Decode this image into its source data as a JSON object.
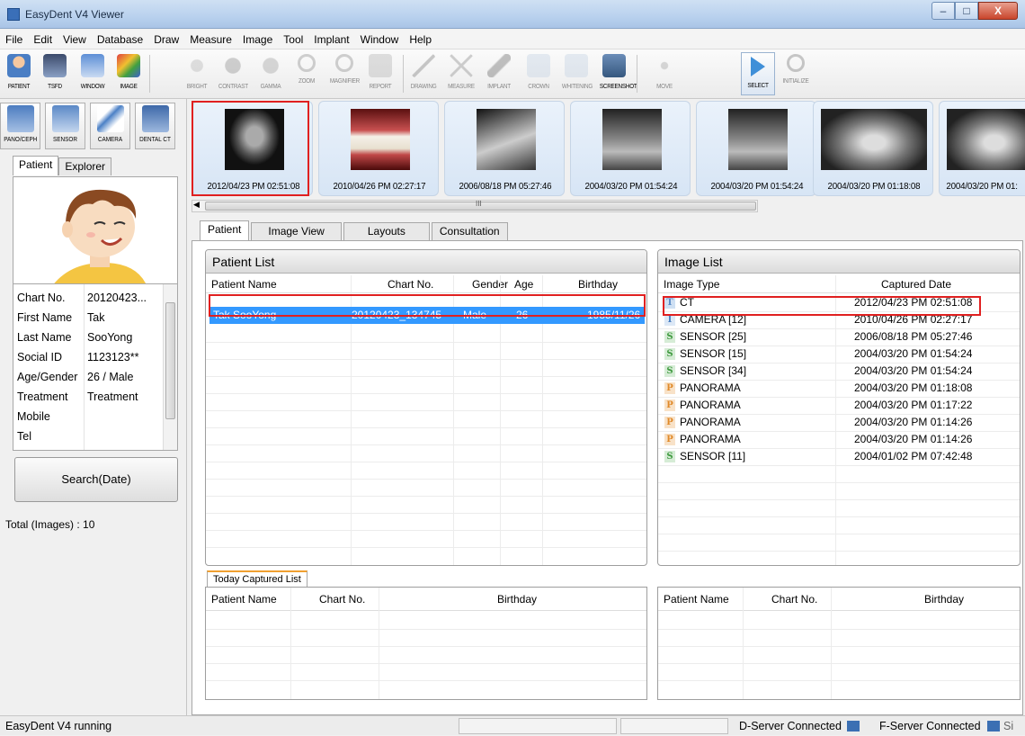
{
  "window": {
    "title": "EasyDent V4 Viewer",
    "min": "–",
    "max": "□",
    "close": "X"
  },
  "menu": [
    "File",
    "Edit",
    "View",
    "Database",
    "Draw",
    "Measure",
    "Image",
    "Tool",
    "Implant",
    "Window",
    "Help"
  ],
  "toolbar": {
    "patient": "PATIENT",
    "tsfd": "TSFD",
    "window": "WINDOW",
    "image": "IMAGE",
    "bright": "BRIGHT",
    "contrast": "CONTRAST",
    "gamma": "GAMMA",
    "zoom": "ZOOM",
    "magnifier": "MAGNIFIER",
    "report": "REPORT",
    "drawing": "DRAWING",
    "measure": "MEASURE",
    "implant": "IMPLANT",
    "crown": "CROWN",
    "whitening": "WHITENING",
    "screenshot": "SCREENSHOT",
    "move": "MOVE",
    "select": "SELECT",
    "initialize": "INITIALIZE"
  },
  "acquire": {
    "pano": "PANO/CEPH",
    "sensor": "SENSOR",
    "camera": "CAMERA",
    "dentalct": "DENTAL CT"
  },
  "left_tabs": {
    "patient": "Patient",
    "explorer": "Explorer"
  },
  "patient_info": [
    {
      "k": "Chart No.",
      "v": "20120423..."
    },
    {
      "k": "First Name",
      "v": "Tak"
    },
    {
      "k": "Last Name",
      "v": "SooYong"
    },
    {
      "k": "Social ID",
      "v": "1123123**"
    },
    {
      "k": "Age/Gender",
      "v": "26 / Male"
    },
    {
      "k": "Treatment",
      "v": "Treatment"
    },
    {
      "k": "Mobile",
      "v": ""
    },
    {
      "k": "Tel",
      "v": ""
    }
  ],
  "search_button": "Search(Date)",
  "total_images": "Total (Images) : 10",
  "thumbnails": [
    "2012/04/23 PM 02:51:08",
    "2010/04/26 PM 02:27:17",
    "2006/08/18 PM 05:27:46",
    "2004/03/20 PM 01:54:24",
    "2004/03/20 PM 01:54:24",
    "2004/03/20 PM 01:18:08",
    "2004/03/20 PM 01:"
  ],
  "hscroll_mark": "III",
  "main_tabs": {
    "patient": "Patient",
    "image_view": "Image View",
    "layouts": "Layouts",
    "consultation": "Consultation"
  },
  "patient_list": {
    "title": "Patient List",
    "headers": {
      "name": "Patient Name",
      "chart": "Chart No.",
      "gender": "Gender",
      "age": "Age",
      "birthday": "Birthday"
    },
    "selected": {
      "name": "Tak SooYong",
      "chart": "20120423_134745",
      "gender": "Male",
      "age": "26",
      "birthday": "1985/11/26"
    }
  },
  "image_list": {
    "title": "Image List",
    "headers": {
      "type": "Image Type",
      "date": "Captured Date"
    },
    "rows": [
      {
        "badge": "T",
        "type": "CT",
        "date": "2012/04/23 PM 02:51:08"
      },
      {
        "badge": "I",
        "type": "CAMERA [12]",
        "date": "2010/04/26 PM 02:27:17"
      },
      {
        "badge": "S",
        "type": "SENSOR [25]",
        "date": "2006/08/18 PM 05:27:46"
      },
      {
        "badge": "S",
        "type": "SENSOR [15]",
        "date": "2004/03/20 PM 01:54:24"
      },
      {
        "badge": "S",
        "type": "SENSOR [34]",
        "date": "2004/03/20 PM 01:54:24"
      },
      {
        "badge": "P",
        "type": "PANORAMA",
        "date": "2004/03/20 PM 01:18:08"
      },
      {
        "badge": "P",
        "type": "PANORAMA",
        "date": "2004/03/20 PM 01:17:22"
      },
      {
        "badge": "P",
        "type": "PANORAMA",
        "date": "2004/03/20 PM 01:14:26"
      },
      {
        "badge": "P",
        "type": "PANORAMA",
        "date": "2004/03/20 PM 01:14:26"
      },
      {
        "badge": "S",
        "type": "SENSOR [11]",
        "date": "2004/01/02 PM 07:42:48"
      }
    ],
    "badge_colors": {
      "T": "#5b8cc8",
      "I": "#4a7fc0",
      "S": "#3f9a3f",
      "P": "#e08a2a"
    }
  },
  "today": {
    "tab": "Today Captured List",
    "left_headers": {
      "name": "Patient Name",
      "chart": "Chart No.",
      "birthday": "Birthday"
    },
    "right_headers": {
      "name": "Patient Name",
      "chart": "Chart No.",
      "birthday": "Birthday"
    }
  },
  "status": {
    "text": "EasyDent V4 running",
    "dserver": "D-Server Connected",
    "fserver": "F-Server Connected",
    "si": "Si"
  }
}
